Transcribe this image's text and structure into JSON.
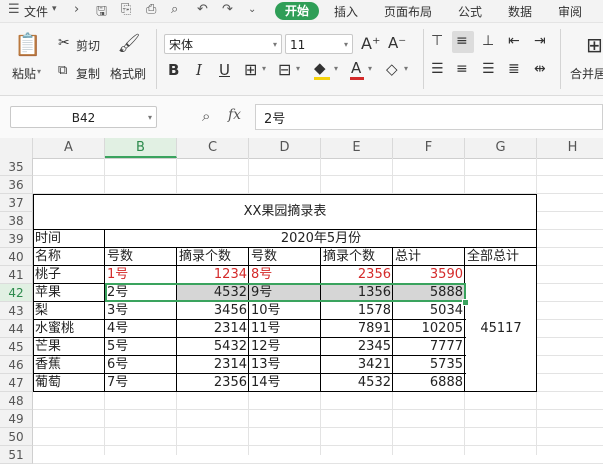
{
  "menubar": {
    "file_label": "文件",
    "tabs": [
      "开始",
      "插入",
      "页面布局",
      "公式",
      "数据",
      "审阅"
    ]
  },
  "ribbon": {
    "paste": "粘贴",
    "cut": "剪切",
    "copy": "复制",
    "format_painter": "格式刷",
    "font_name": "宋体",
    "font_size": "11",
    "merge": "合并居"
  },
  "formula_bar": {
    "name_box": "B42",
    "fx": "fx",
    "content": "2号"
  },
  "columns": [
    "A",
    "B",
    "C",
    "D",
    "E",
    "F",
    "G",
    "H"
  ],
  "selected_column": "B",
  "rows": [
    "35",
    "36",
    "37",
    "38",
    "39",
    "40",
    "41",
    "42",
    "43",
    "44",
    "45",
    "46",
    "47",
    "48",
    "49",
    "50",
    "51"
  ],
  "selected_row": "42",
  "sheet": {
    "title": "XX果园摘录表",
    "time_label": "时间",
    "month": "2020年5月份",
    "headers": [
      "名称",
      "号数",
      "摘录个数",
      "号数",
      "摘录个数",
      "总计",
      "全部总计"
    ],
    "data": [
      [
        "桃子",
        "1号",
        "1234",
        "8号",
        "2356",
        "3590"
      ],
      [
        "苹果",
        "2号",
        "4532",
        "9号",
        "1356",
        "5888"
      ],
      [
        "梨",
        "3号",
        "3456",
        "10号",
        "1578",
        "5034"
      ],
      [
        "水蜜桃",
        "4号",
        "2314",
        "11号",
        "7891",
        "10205"
      ],
      [
        "芒果",
        "5号",
        "5432",
        "12号",
        "2345",
        "7777"
      ],
      [
        "香蕉",
        "6号",
        "2314",
        "13号",
        "3421",
        "5735"
      ],
      [
        "葡萄",
        "7号",
        "2356",
        "14号",
        "4532",
        "6888"
      ]
    ],
    "grand_total": "45117"
  },
  "colors": {
    "accent": "#2f9e57",
    "highlight_red": "#d42a2a",
    "selection": "#3aa35e"
  }
}
